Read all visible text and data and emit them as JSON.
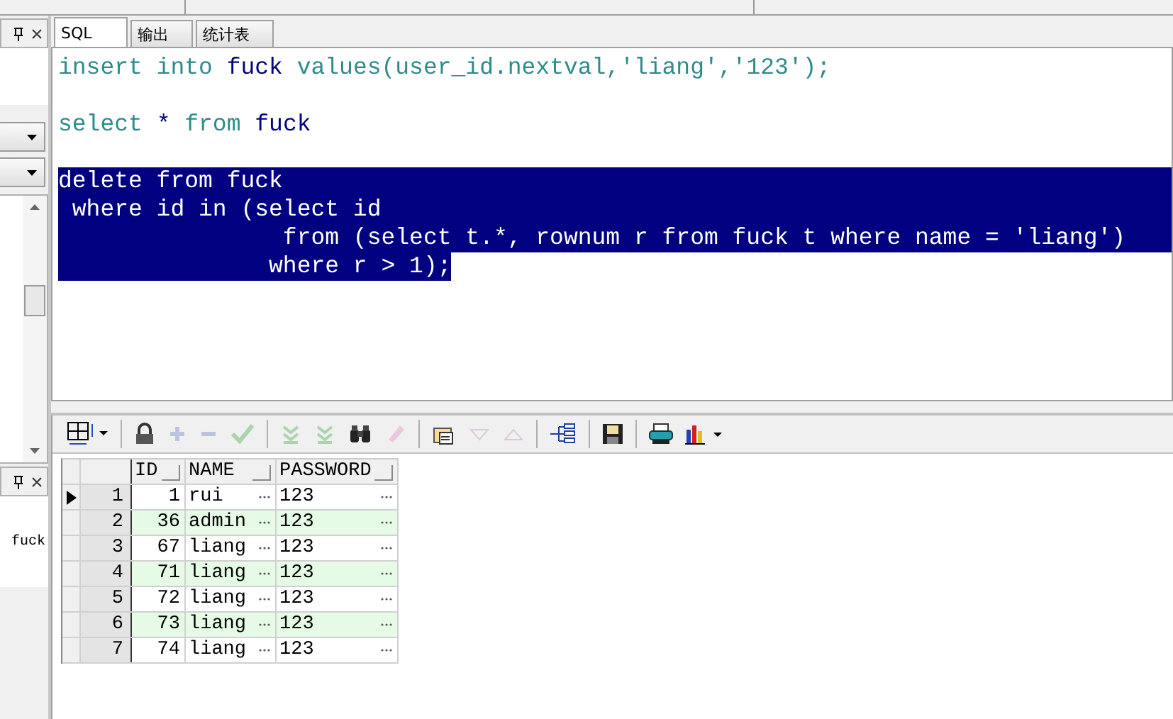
{
  "side_panel": {
    "list_items": [
      {
        "label": "fuck"
      }
    ]
  },
  "tabs": [
    {
      "label": "SQL",
      "selected": true
    },
    {
      "label": "输出",
      "selected": false
    },
    {
      "label": "统计表",
      "selected": false
    }
  ],
  "editor": {
    "lines": [
      {
        "selected": false,
        "segments": [
          {
            "kind": "keyword",
            "text": "insert into "
          },
          {
            "kind": "ident",
            "text": "fuck "
          },
          {
            "kind": "keyword",
            "text": "values(user_id.nextval,'liang','123');"
          }
        ]
      },
      {
        "selected": false
      },
      {
        "selected": false,
        "segments": [
          {
            "kind": "keyword",
            "text": "select "
          },
          {
            "kind": "ident",
            "text": "* "
          },
          {
            "kind": "keyword",
            "text": "from "
          },
          {
            "kind": "ident",
            "text": "fuck"
          }
        ]
      },
      {
        "selected": false
      },
      {
        "selected": true,
        "segments": [
          {
            "kind": "keyword",
            "text": "delete from fuck"
          }
        ]
      },
      {
        "selected": true,
        "segments": [
          {
            "kind": "keyword",
            "text": " where id in (select id"
          }
        ]
      },
      {
        "selected": true,
        "segments": [
          {
            "kind": "keyword",
            "text": "                from (select t.*, rownum r from fuck t where name = 'liang')"
          }
        ]
      },
      {
        "selected": true,
        "segments": [
          {
            "kind": "keyword",
            "text": "               where r > 1);"
          }
        ]
      }
    ]
  },
  "toolbar": [
    {
      "kind": "grid",
      "disabled": false
    },
    {
      "kind": "lock",
      "disabled": false
    },
    {
      "kind": "plus",
      "disabled": true
    },
    {
      "kind": "minus",
      "disabled": true
    },
    {
      "kind": "check",
      "disabled": true
    },
    {
      "kind": "down2",
      "disabled": true
    },
    {
      "kind": "down2",
      "disabled": true
    },
    {
      "kind": "binoculars",
      "disabled": false
    },
    {
      "kind": "eraser",
      "disabled": true
    },
    {
      "kind": "clipboard",
      "disabled": false
    },
    {
      "kind": "tri-down",
      "disabled": true
    },
    {
      "kind": "tri-up",
      "disabled": true
    },
    {
      "kind": "tree",
      "disabled": false
    },
    {
      "kind": "save",
      "disabled": false
    },
    {
      "kind": "printer",
      "disabled": false
    },
    {
      "kind": "chart",
      "disabled": false
    }
  ],
  "table": {
    "columns": [
      "ID",
      "NAME",
      "PASSWORD"
    ],
    "rows": [
      {
        "number": "1",
        "current": true,
        "cells": [
          "1",
          "rui",
          "123"
        ]
      },
      {
        "number": "2",
        "current": false,
        "cells": [
          "36",
          "admin",
          "123"
        ]
      },
      {
        "number": "3",
        "current": false,
        "cells": [
          "67",
          "liang",
          "123"
        ]
      },
      {
        "number": "4",
        "current": false,
        "cells": [
          "71",
          "liang",
          "123"
        ]
      },
      {
        "number": "5",
        "current": false,
        "cells": [
          "72",
          "liang",
          "123"
        ]
      },
      {
        "number": "6",
        "current": false,
        "cells": [
          "73",
          "liang",
          "123"
        ]
      },
      {
        "number": "7",
        "current": false,
        "cells": [
          "74",
          "liang",
          "123"
        ]
      }
    ]
  }
}
